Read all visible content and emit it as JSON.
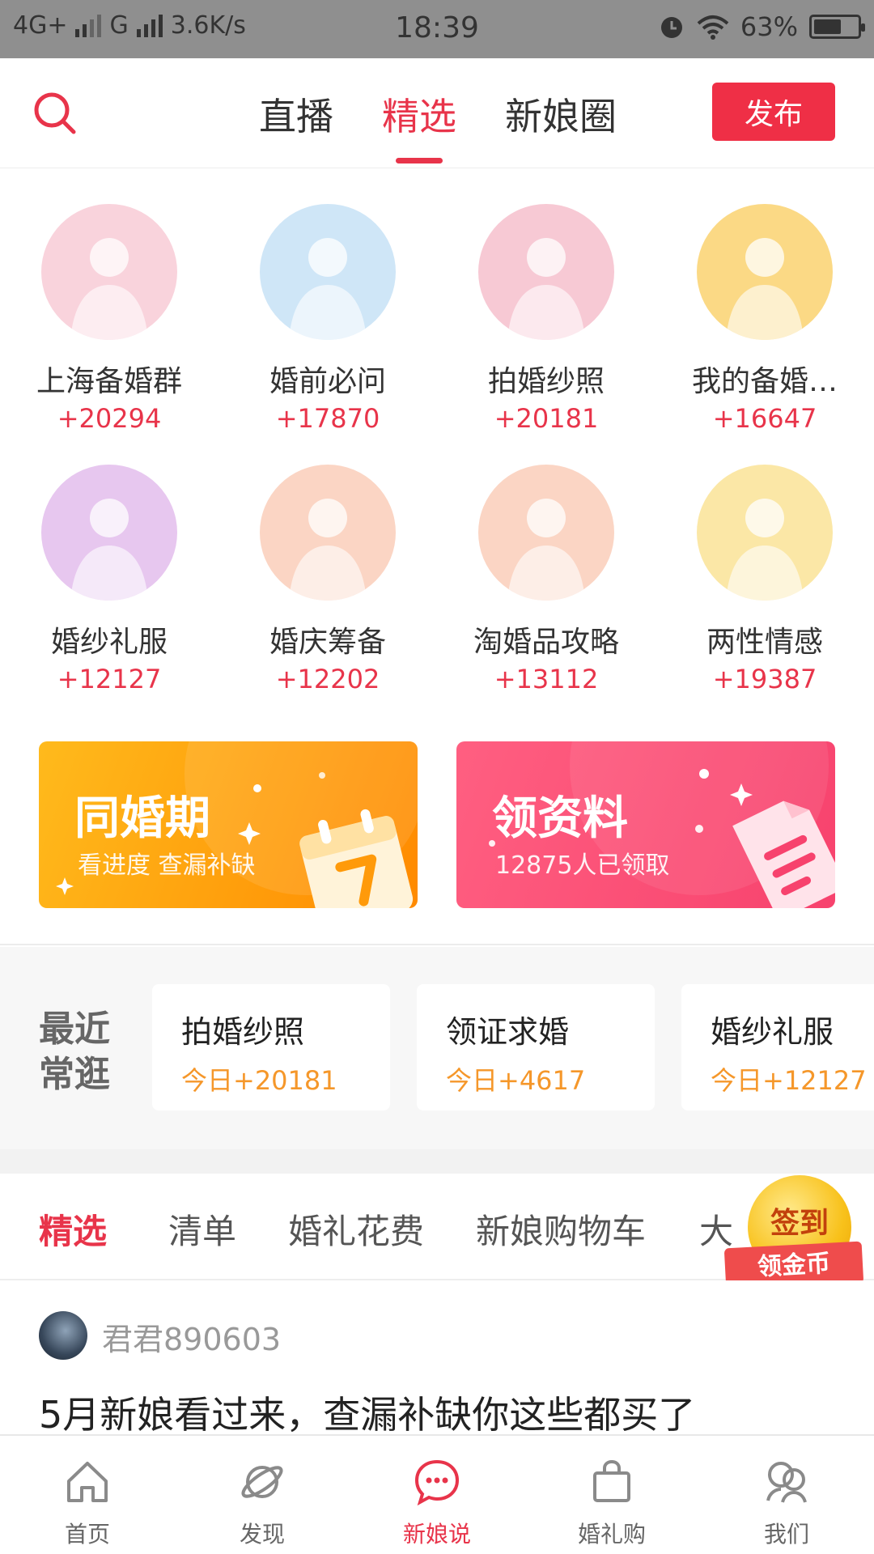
{
  "status_bar": {
    "network1": "4G+",
    "network2": "G",
    "speed": "3.6K/s",
    "time": "18:39",
    "battery": "63%",
    "battery_level": 0.63
  },
  "header": {
    "tabs": [
      "直播",
      "精选",
      "新娘圈"
    ],
    "active_tab": "精选",
    "publish_label": "发布"
  },
  "groups": [
    {
      "name": "上海备婚群",
      "count": "+20294",
      "icon": "storybook-gift-icon",
      "bg": "#f9d3dc"
    },
    {
      "name": "婚前必问",
      "count": "+17870",
      "icon": "woman-portrait-icon",
      "bg": "#cfe6f7"
    },
    {
      "name": "拍婚纱照",
      "count": "+20181",
      "icon": "couple-photo-icon",
      "bg": "#f7c9d4"
    },
    {
      "name": "我的备婚…",
      "count": "+16647",
      "icon": "wedding-card-icon",
      "bg": "#fbd985"
    },
    {
      "name": "婚纱礼服",
      "count": "+12127",
      "icon": "bride-dress-icon",
      "bg": "#e7c7ef"
    },
    {
      "name": "婚庆筹备",
      "count": "+12202",
      "icon": "red-gift-box-icon",
      "bg": "#fbd5c4"
    },
    {
      "name": "淘婚品攻略",
      "count": "+13112",
      "icon": "wedding-goods-icon",
      "bg": "#fbd5c4"
    },
    {
      "name": "两性情感",
      "count": "+19387",
      "icon": "couple-emotion-icon",
      "bg": "#fbe7a6"
    }
  ],
  "promos": [
    {
      "title": "同婚期",
      "subtitle": "看进度 查漏补缺",
      "icon": "calendar-icon"
    },
    {
      "title": "领资料",
      "subtitle": "12875人已领取",
      "icon": "document-icon"
    }
  ],
  "recent": {
    "label_line1": "最近",
    "label_line2": "常逛",
    "cards": [
      {
        "title": "拍婚纱照",
        "today": "今日+20181"
      },
      {
        "title": "领证求婚",
        "today": "今日+4617"
      },
      {
        "title": "婚纱礼服",
        "today": "今日+12127"
      }
    ]
  },
  "subtabs": [
    "精选",
    "清单",
    "婚礼花费",
    "新娘购物车",
    "大"
  ],
  "checkin": {
    "top": "签到",
    "bottom": "领金币"
  },
  "post": {
    "username": "君君890603",
    "title": "5月新娘看过来，查漏补缺你这些都买了"
  },
  "bottom_nav": [
    {
      "label": "首页",
      "icon": "home-icon"
    },
    {
      "label": "发现",
      "icon": "planet-icon"
    },
    {
      "label": "新娘说",
      "icon": "chat-bubble-icon"
    },
    {
      "label": "婚礼购",
      "icon": "shopping-bag-icon"
    },
    {
      "label": "我们",
      "icon": "people-icon"
    }
  ],
  "colors": {
    "accent": "#e8344a",
    "orange_text": "#f5972a",
    "promo_orange": "#ffa10f",
    "promo_pink": "#f9557a"
  }
}
